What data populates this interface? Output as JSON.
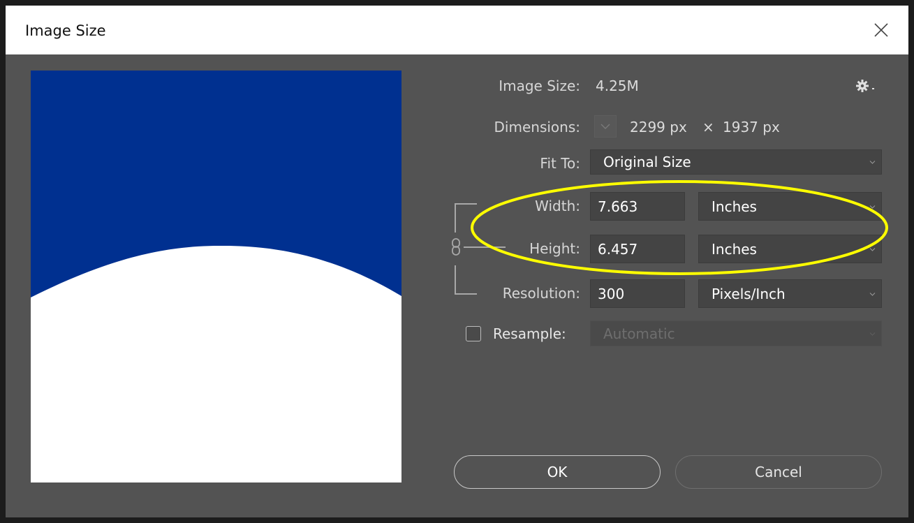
{
  "dialog": {
    "title": "Image Size"
  },
  "info": {
    "image_size_label": "Image Size:",
    "image_size_value": "4.25M",
    "dimensions_label": "Dimensions:",
    "dimensions_width": "2299 px",
    "dimensions_x": "×",
    "dimensions_height": "1937 px"
  },
  "fit_to": {
    "label": "Fit To:",
    "value": "Original Size"
  },
  "width": {
    "label": "Width:",
    "value": "7.663",
    "unit": "Inches"
  },
  "height": {
    "label": "Height:",
    "value": "6.457",
    "unit": "Inches"
  },
  "resolution": {
    "label": "Resolution:",
    "value": "300",
    "unit": "Pixels/Inch"
  },
  "resample": {
    "label": "Resample:",
    "checked": false,
    "value": "Automatic"
  },
  "buttons": {
    "ok": "OK",
    "cancel": "Cancel"
  },
  "colors": {
    "dialog_bg": "#535353",
    "preview_blue": "#003090",
    "annotation_yellow": "#ffff00"
  },
  "icons": {
    "settings": "gear-icon",
    "close": "close-icon",
    "link": "chain-link-icon",
    "dropdown": "chevron-down-icon"
  }
}
